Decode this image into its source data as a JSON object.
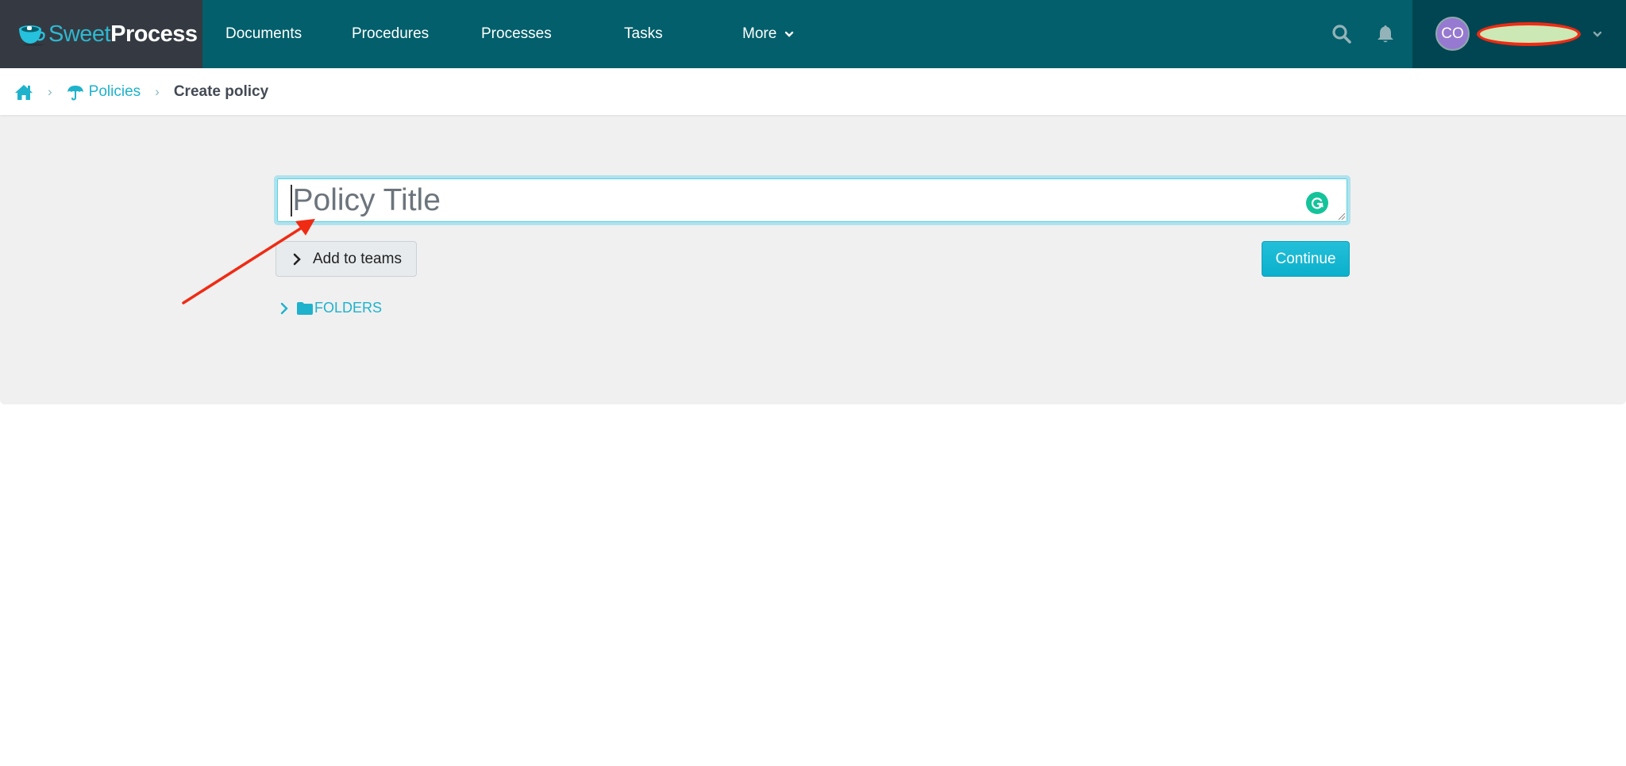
{
  "header": {
    "logo": {
      "part1": "Sweet",
      "part2": "Process"
    },
    "nav": [
      {
        "label": "Documents"
      },
      {
        "label": "Procedures"
      },
      {
        "label": "Processes"
      },
      {
        "label": "Tasks"
      },
      {
        "label": "More"
      }
    ],
    "icons": {
      "search": "search-icon",
      "notifications": "bell-icon"
    },
    "user": {
      "initials": "CO",
      "name_redacted": true
    }
  },
  "breadcrumb": {
    "home_icon": "home-icon",
    "items": [
      {
        "label": "Policies",
        "icon": "umbrella-icon"
      },
      {
        "label": "Create policy"
      }
    ]
  },
  "form": {
    "title_input": {
      "value": "",
      "placeholder": "Policy Title"
    },
    "add_to_teams_label": "Add to teams",
    "continue_label": "Continue",
    "folders_label": "FOLDERS"
  },
  "colors": {
    "header_bg": "#025f6b",
    "logo_bg": "#353a42",
    "user_bg": "#004551",
    "accent": "#1fb2cc",
    "continue_bg": "#0bb0cc",
    "avatar_bg": "#9679d0",
    "annotation": "#ef2b14"
  }
}
